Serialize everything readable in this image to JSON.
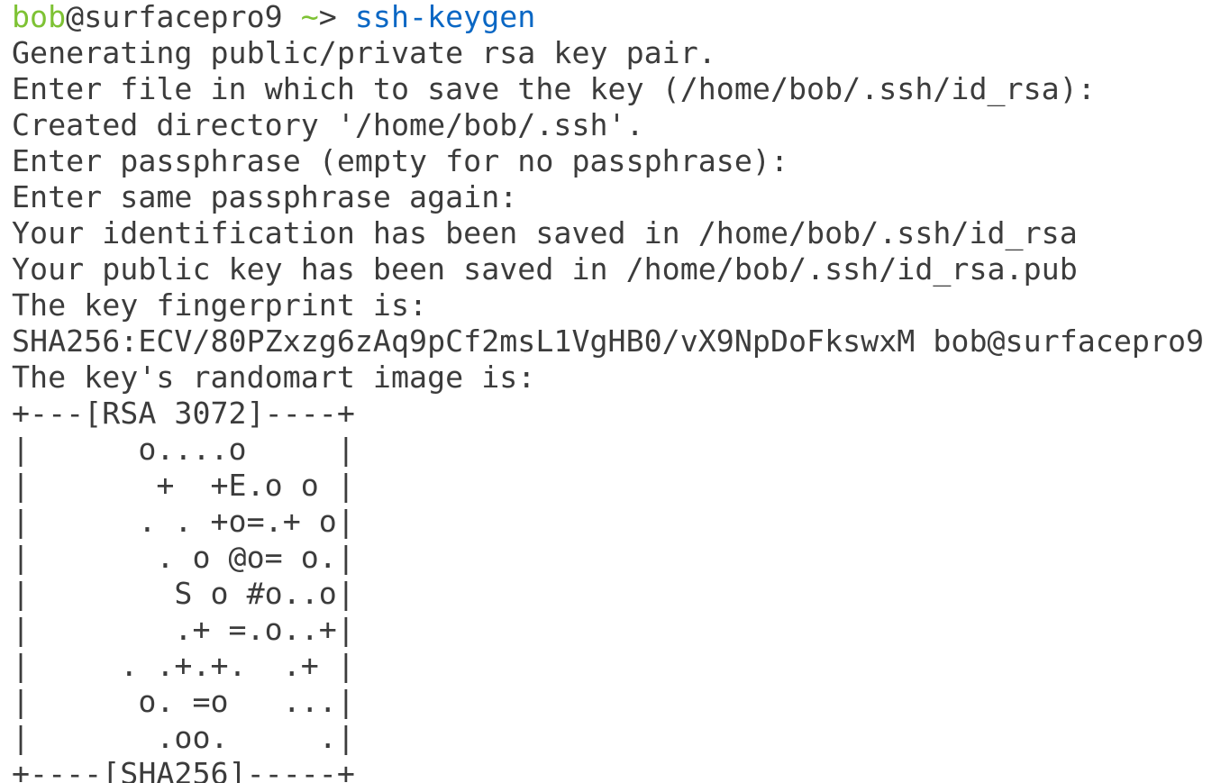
{
  "colors": {
    "background": "#ffffff",
    "text": "#3c3c3c",
    "prompt_user": "#7ec234",
    "prompt_cwd": "#7ec234",
    "command": "#0a67c4"
  },
  "prompt": {
    "user": "bob",
    "at": "@",
    "host": "surfacepro9",
    "cwd": "~",
    "symbol": "> ",
    "command": "ssh-keygen"
  },
  "output_lines": [
    "Generating public/private rsa key pair.",
    "Enter file in which to save the key (/home/bob/.ssh/id_rsa):",
    "Created directory '/home/bob/.ssh'.",
    "Enter passphrase (empty for no passphrase):",
    "Enter same passphrase again:",
    "Your identification has been saved in /home/bob/.ssh/id_rsa",
    "Your public key has been saved in /home/bob/.ssh/id_rsa.pub",
    "The key fingerprint is:",
    "SHA256:ECV/80PZxzg6zAq9pCf2msL1VgHB0/vX9NpDoFkswxM bob@surfacepro9",
    "The key's randomart image is:"
  ],
  "randomart": {
    "header": "+---[RSA 3072]----+",
    "rows": [
      "|      o....o     |",
      "|       +  +E.o o |",
      "|      . . +o=.+ o|",
      "|       . o @o= o.|",
      "|        S o #o..o|",
      "|        .+ =.o..+|",
      "|     . .+.+.  .+ |",
      "|      o. =o   ...|",
      "|       .oo.     .|"
    ],
    "footer": "+----[SHA256]-----+"
  }
}
